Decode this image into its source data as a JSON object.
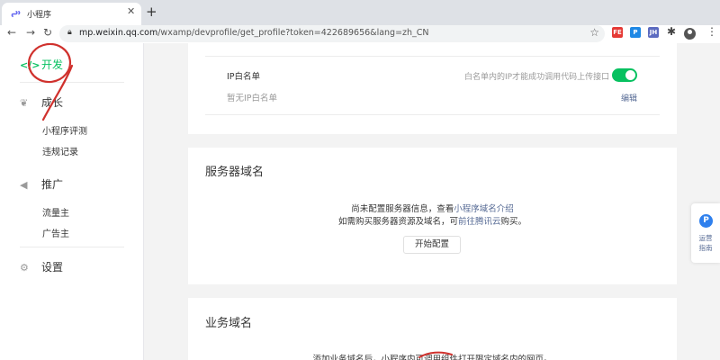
{
  "browser": {
    "tab_title": "小程序",
    "tab_close": "✕",
    "new_tab": "+",
    "url_host": "mp.weixin.qq.com",
    "url_path": "/wxamp/devprofile/get_profile?token=422689656&lang=zh_CN",
    "extensions": [
      {
        "name": "FE",
        "color": "#e53935"
      },
      {
        "name": "P",
        "color": "#1e88e5"
      },
      {
        "name": "JH",
        "color": "#5c6bc0"
      }
    ]
  },
  "sidebar": {
    "sections": [
      {
        "label": "开发",
        "icon": "code-icon",
        "active": true,
        "items": []
      },
      {
        "label": "成长",
        "icon": "sprout-icon",
        "active": false,
        "items": [
          "小程序评测",
          "违规记录"
        ]
      },
      {
        "label": "推广",
        "icon": "megaphone-icon",
        "active": false,
        "items": [
          "流量主",
          "广告主"
        ]
      },
      {
        "label": "设置",
        "icon": "gear-icon",
        "active": false,
        "items": []
      }
    ]
  },
  "ip_whitelist": {
    "label": "IP白名单",
    "empty_text": "暂无IP白名单",
    "hint": "白名单内的IP才能成功调用代码上传接口",
    "toggle_on": true,
    "edit_label": "编辑"
  },
  "server_domain": {
    "title": "服务器域名",
    "line1_prefix": "尚未配置服务器信息，查看",
    "line1_link": "小程序域名介绍",
    "line2_prefix": "如需购买服务器资源及域名，可",
    "line2_link": "前往腾讯云",
    "line2_suffix": "购买。",
    "button": "开始配置"
  },
  "business_domain": {
    "title": "业务域名",
    "desc": "添加业务域名后，小程序内可调用组件打开限定域名内的网页。"
  },
  "float_panel": {
    "icon_letter": "P",
    "label_line1": "运营",
    "label_line2": "指南"
  },
  "colors": {
    "accent": "#07c160",
    "link": "#576b95",
    "annotation": "#d0312d"
  }
}
